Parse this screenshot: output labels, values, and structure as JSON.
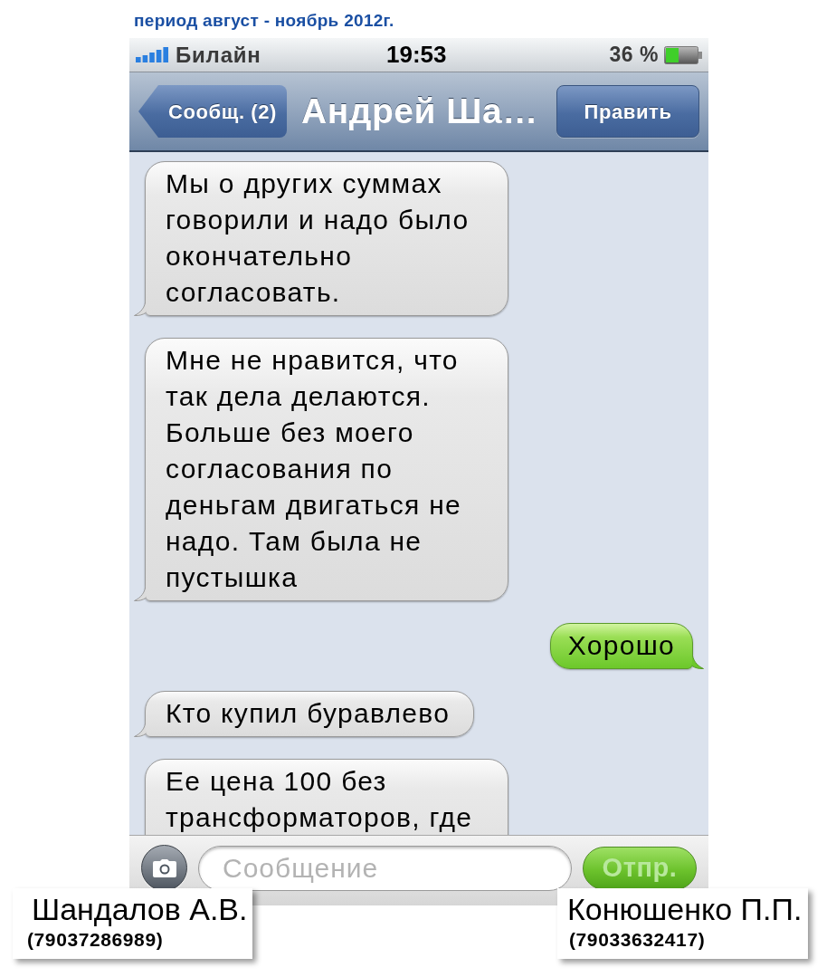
{
  "caption": "период август - ноябрь 2012г.",
  "status_bar": {
    "carrier": "Билайн",
    "time": "19:53",
    "battery": "36 %"
  },
  "nav_bar": {
    "back_button": "Сообщ. (2)",
    "title": "Андрей Ша…",
    "edit_button": "Править"
  },
  "messages": [
    {
      "kind": "incoming",
      "text": "Мы о других суммах говорили и надо было окончательно согласовать.",
      "cut_off": false
    },
    {
      "kind": "incoming",
      "text": "Мне не нравится, что так дела делаются. Больше без моего согласования по деньгам двигаться не надо. Там была не пустышка",
      "cut_off": false
    },
    {
      "kind": "outgoing",
      "text": "Хорошо",
      "cut_off": false
    },
    {
      "kind": "incoming",
      "text": "Кто купил буравлево",
      "cut_off": false
    },
    {
      "kind": "incoming",
      "text": "Ее цена 100 без трансформаторов, где",
      "cut_off": true
    }
  ],
  "composer": {
    "placeholder": "Сообщение",
    "send_button": {
      "label": "Отпр.",
      "disabled": true
    }
  },
  "contacts": [
    {
      "name": "Шандалов А.В.",
      "phone": "(79037286989)"
    },
    {
      "name": "Конюшенко П.П.",
      "phone": "(79033632417)"
    }
  ]
}
